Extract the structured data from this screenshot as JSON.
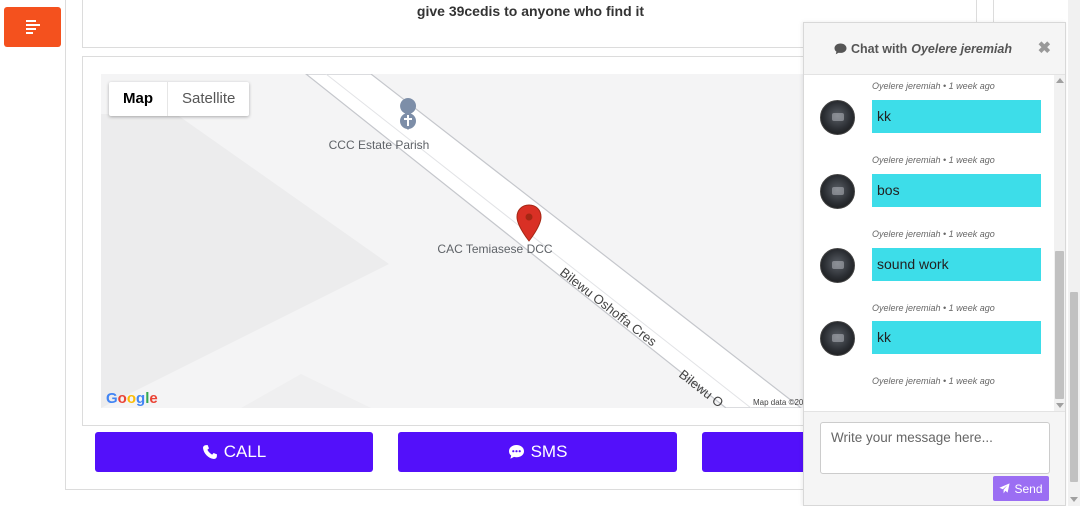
{
  "menu": {
    "icon": "align-left-icon"
  },
  "post": {
    "description": "give 39cedis to anyone who find it"
  },
  "map": {
    "type_options": [
      "Map",
      "Satellite"
    ],
    "active_type": "Map",
    "places": [
      {
        "name": "CCC Estate Parish",
        "icon": "church-icon"
      },
      {
        "name": "CAC Temiasese DCC",
        "icon": "location-pin-icon"
      }
    ],
    "road_label_1": "Bilewu Oshoffa Cres",
    "road_label_2": "Bilewu O",
    "attribution": "Map data ©20",
    "logo": "Google",
    "colors": {
      "pin": "#d93025",
      "road_border": "#c5c7cc",
      "land": "#f4f4f5"
    }
  },
  "actions": {
    "call_label": "CALL",
    "call_icon": "phone-icon",
    "sms_label": "SMS",
    "sms_icon": "sms-bubble-icon",
    "color": "#5310fa"
  },
  "chat": {
    "prefix": "Chat with",
    "contact_name": "Oyelere jeremiah",
    "header_icon": "comment-icon",
    "close_symbol": "✖",
    "messages": [
      {
        "meta": "Oyelere jeremiah • 1 week ago",
        "text": "kk"
      },
      {
        "meta": "Oyelere jeremiah • 1 week ago",
        "text": "bos"
      },
      {
        "meta": "Oyelere jeremiah • 1 week ago",
        "text": "sound work"
      },
      {
        "meta": "Oyelere jeremiah • 1 week ago",
        "text": "kk"
      },
      {
        "meta": "Oyelere jeremiah • 1 week ago",
        "text": ""
      }
    ],
    "input_placeholder": "Write your message here...",
    "send_label": "Send",
    "send_icon": "paper-plane-icon",
    "bubble_color": "#3ddde9",
    "send_color": "#9b6ef3"
  }
}
